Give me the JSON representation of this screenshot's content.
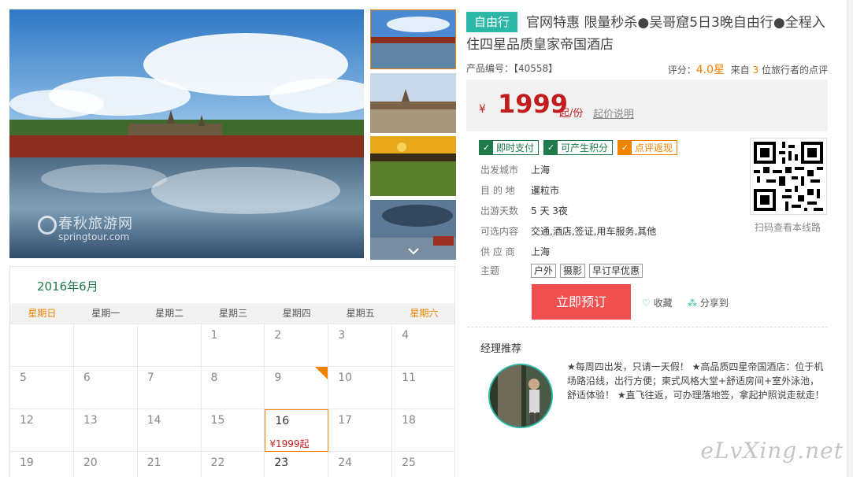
{
  "photo": {
    "watermark_cn": "春秋旅游网",
    "watermark_en": "springtour.com"
  },
  "calendar": {
    "month_label": "2016年6月",
    "weekdays": [
      "星期日",
      "星期一",
      "星期二",
      "星期三",
      "星期四",
      "星期五",
      "星期六"
    ],
    "weeks": [
      [
        "",
        "",
        "",
        "1",
        "2",
        "3",
        "4"
      ],
      [
        "5",
        "6",
        "7",
        "8",
        "9",
        "10",
        "11"
      ],
      [
        "12",
        "13",
        "14",
        "15",
        "16",
        "17",
        "18"
      ],
      [
        "19",
        "20",
        "21",
        "22",
        "23",
        "24",
        "25"
      ]
    ],
    "selected_day": "16",
    "selected_price": "¥1999起",
    "flagged_day": "9"
  },
  "product": {
    "tag": "自由行",
    "title": "官网特惠 限量秒杀●吴哥窟5日3晚自由行●全程入住四星品质皇家帝国酒店",
    "code_label": "产品编号：【40558】",
    "rating_label": "评分：",
    "rating_score": "4.0",
    "rating_unit": "星",
    "review_prefix": "来自",
    "review_count": "3",
    "review_suffix": "位旅行者的点评",
    "price_currency": "¥",
    "price_amount": "1999",
    "price_unit": "起/份",
    "price_explain": "起价说明",
    "badges": [
      "即时支付",
      "可产生积分",
      "点评返现"
    ],
    "attrs": {
      "depart_label": "出发城市",
      "depart_value": "上海",
      "dest_label": "目 的 地",
      "dest_value": "暹粒市",
      "days_label": "出游天数",
      "days_value": "5 天 3夜",
      "options_label": "可选内容",
      "options_value": "交通,酒店,签证,用车服务,其他",
      "supplier_label": "供 应 商",
      "supplier_value": "上海",
      "theme_label": "主题",
      "themes": [
        "户外",
        "摄影",
        "早订早优惠"
      ]
    },
    "qr_caption": "扫码查看本线路",
    "book_label": "立即预订",
    "fav_label": "收藏",
    "share_label": "分享到"
  },
  "manager": {
    "title": "经理推荐",
    "text": "★每周四出发，只请一天假！ ★高品质四星帝国酒店：位于机场路沿线，出行方便；柬式风格大堂+舒适房间+室外泳池，舒适体验！ ★直飞往返，可办理落地签，拿起护照说走就走！"
  },
  "site_watermark": "eLvXing.net",
  "colors": {
    "accent_green": "#1f7a4c",
    "teal": "#2cb7a6",
    "orange": "#f08300",
    "price_red": "#c21d1d",
    "book_red": "#f05050"
  }
}
